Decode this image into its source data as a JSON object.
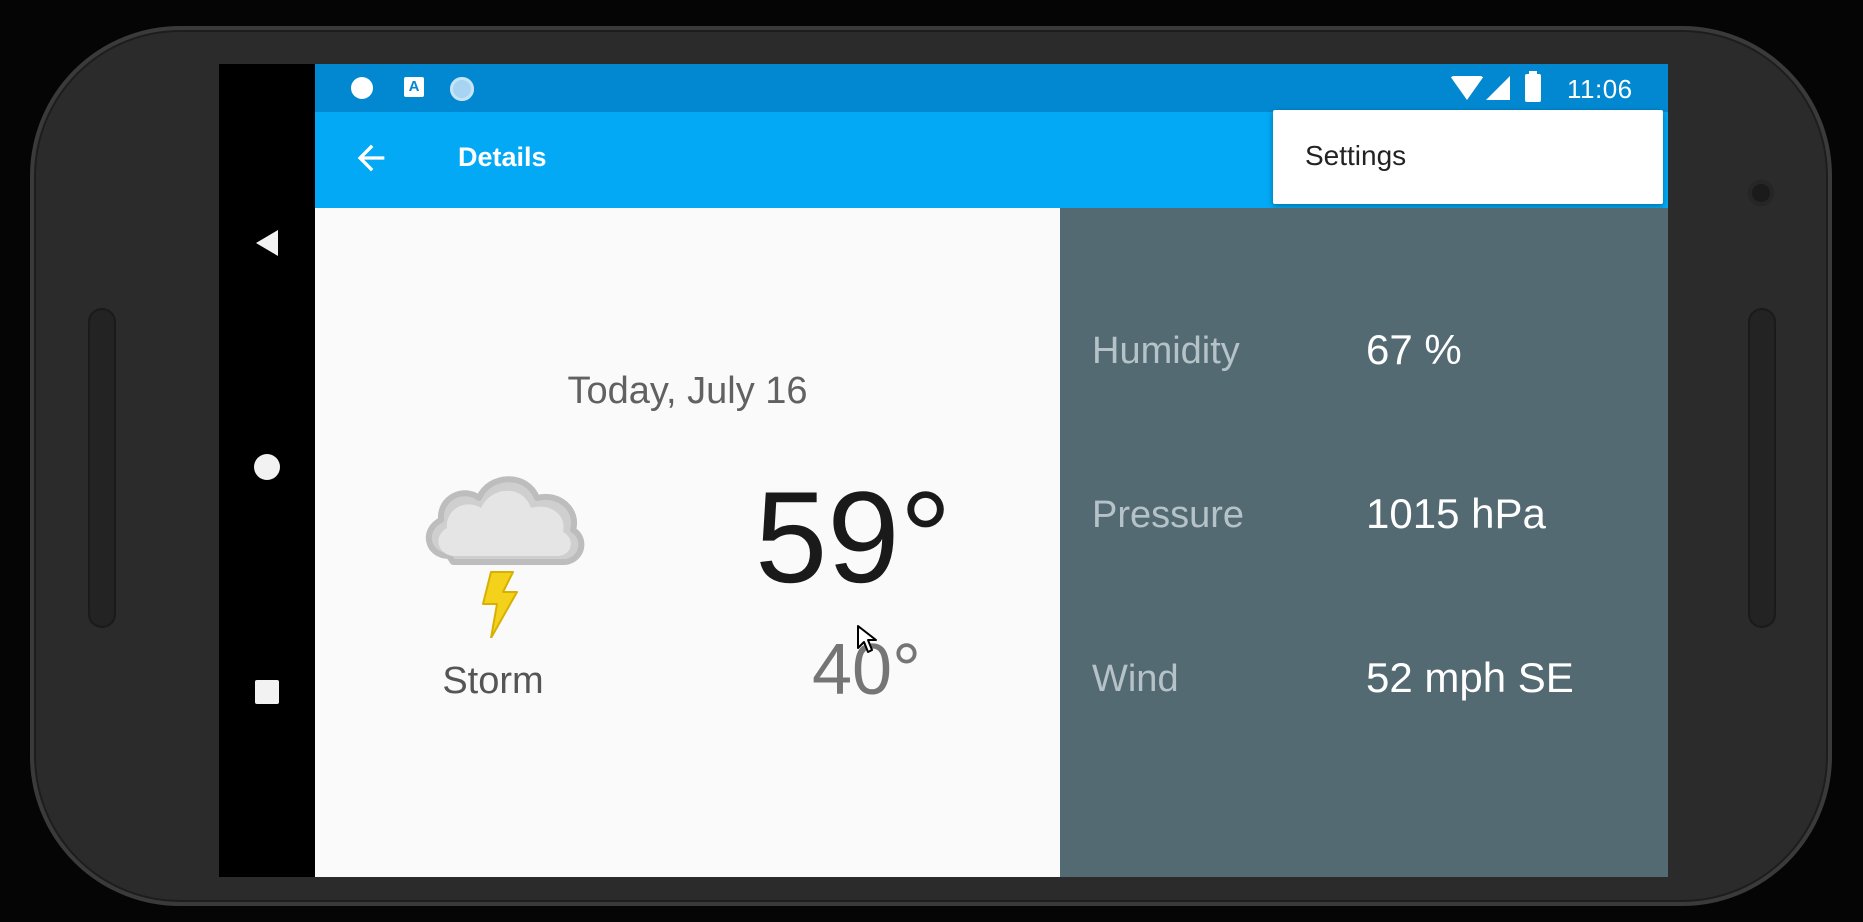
{
  "status_bar": {
    "time": "11:06",
    "notification_icons": [
      "bug-icon",
      "a-badge-icon",
      "circle-icon"
    ],
    "system_icons": [
      "wifi-icon",
      "signal-icon",
      "battery-icon"
    ]
  },
  "app_bar": {
    "title": "Details",
    "back_icon": "arrow-back-icon",
    "color": "#03a9f4",
    "status_color": "#0288d1"
  },
  "overflow_menu": {
    "items": [
      {
        "label": "Settings"
      }
    ]
  },
  "forecast": {
    "date": "Today, July 16",
    "high": "59°",
    "low": "40°",
    "condition": "Storm",
    "icon": "storm-icon"
  },
  "details": [
    {
      "label": "Humidity",
      "value": "67 %"
    },
    {
      "label": "Pressure",
      "value": "1015 hPa"
    },
    {
      "label": "Wind",
      "value": "52 mph SE"
    }
  ],
  "colors": {
    "detail_panel": "#536a72",
    "detail_label": "#b5c3c8",
    "main_background": "#fafafa"
  }
}
